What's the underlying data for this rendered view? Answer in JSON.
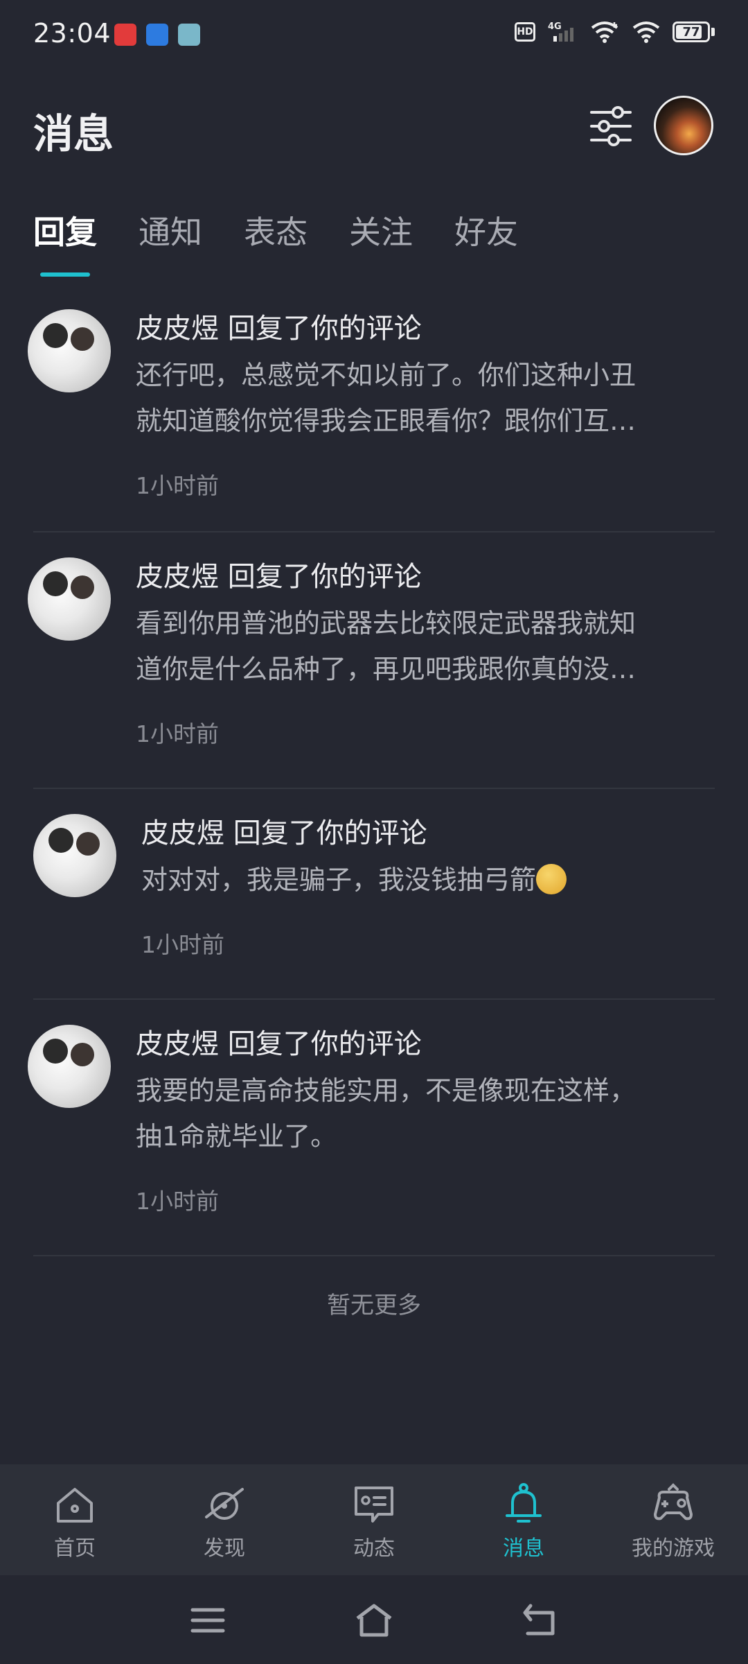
{
  "status_bar": {
    "time": "23:04",
    "network": "4G",
    "battery": "77",
    "hd": "HD"
  },
  "header": {
    "title": "消息"
  },
  "tabs": [
    {
      "label": "回复"
    },
    {
      "label": "通知"
    },
    {
      "label": "表态"
    },
    {
      "label": "关注"
    },
    {
      "label": "好友"
    }
  ],
  "replies": [
    {
      "user": "皮皮煜",
      "action": "回复了你的评论",
      "line1": "还行吧，总感觉不如以前了。你们这种小丑",
      "line2": "就知道酸你觉得我会正眼看你？跟你们互…",
      "time": "1小时前"
    },
    {
      "user": "皮皮煜",
      "action": "回复了你的评论",
      "line1": "看到你用普池的武器去比较限定武器我就知",
      "line2": "道你是什么品种了，再见吧我跟你真的没…",
      "time": "1小时前"
    },
    {
      "user": "皮皮煜",
      "action": "回复了你的评论",
      "line1": "对对对，我是骗子，我没钱抽弓箭",
      "time": "1小时前"
    },
    {
      "user": "皮皮煜",
      "action": "回复了你的评论",
      "line1": "我要的是高命技能实用，不是像现在这样，",
      "line2": "抽1命就毕业了。",
      "time": "1小时前"
    }
  ],
  "list_end": "暂无更多",
  "bottom_nav": [
    {
      "label": "首页",
      "icon": "home-icon"
    },
    {
      "label": "发现",
      "icon": "planet-icon"
    },
    {
      "label": "动态",
      "icon": "feed-icon"
    },
    {
      "label": "消息",
      "icon": "bell-icon"
    },
    {
      "label": "我的游戏",
      "icon": "gamepad-icon"
    }
  ],
  "colors": {
    "background": "#252731",
    "accent": "#1fc1cf",
    "nav_background": "#2d3039"
  }
}
